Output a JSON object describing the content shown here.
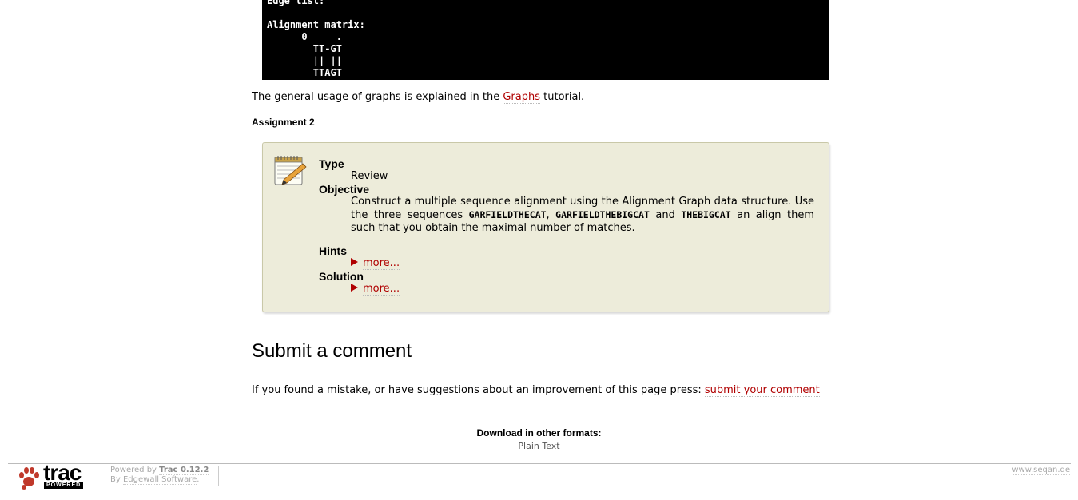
{
  "code": {
    "line1": "Edge list:",
    "line2": "",
    "line3": "Alignment matrix:",
    "line4": "      0     .",
    "line5": "        TT-GT",
    "line6": "        || ||",
    "line7": "        TTAGT"
  },
  "intro": {
    "before": "The general usage of graphs is explained in the ",
    "link": "Graphs",
    "after": " tutorial."
  },
  "assignment": {
    "heading": "Assignment 2",
    "icon": "notepad-pencil-icon",
    "type_label": "Type",
    "type_value": "Review",
    "objective_label": "Objective",
    "objective_1": "Construct a multiple sequence alignment using the Alignment Graph data structure. Use the three sequences ",
    "seq1": "GARFIELDTHECAT",
    "sep1": ", ",
    "seq2": "GARFIELDTHEBIGCAT",
    "sep2": " and ",
    "seq3": "THEBIGCAT",
    "objective_2": " an align them such that you obtain the maximal number of matches.",
    "hints_label": "Hints",
    "hints_more": "more...",
    "solution_label": "Solution",
    "solution_more": "more..."
  },
  "comment": {
    "title": "Submit a comment",
    "text": "If you found a mistake, or have suggestions about an improvement of this page press: ",
    "link": "submit your comment"
  },
  "download": {
    "title": "Download in other formats:",
    "plain_text": "Plain Text"
  },
  "footer": {
    "logo_word": "trac",
    "logo_powered": "POWERED",
    "powered_by": "Powered by ",
    "trac_version": "Trac 0.12.2",
    "by": "By ",
    "edgewall": "Edgewall Software",
    "period": ".",
    "site": "www.seqan.de"
  },
  "colors": {
    "link": "#b00000",
    "box_bg": "#edecda",
    "code_bg": "#000000"
  }
}
